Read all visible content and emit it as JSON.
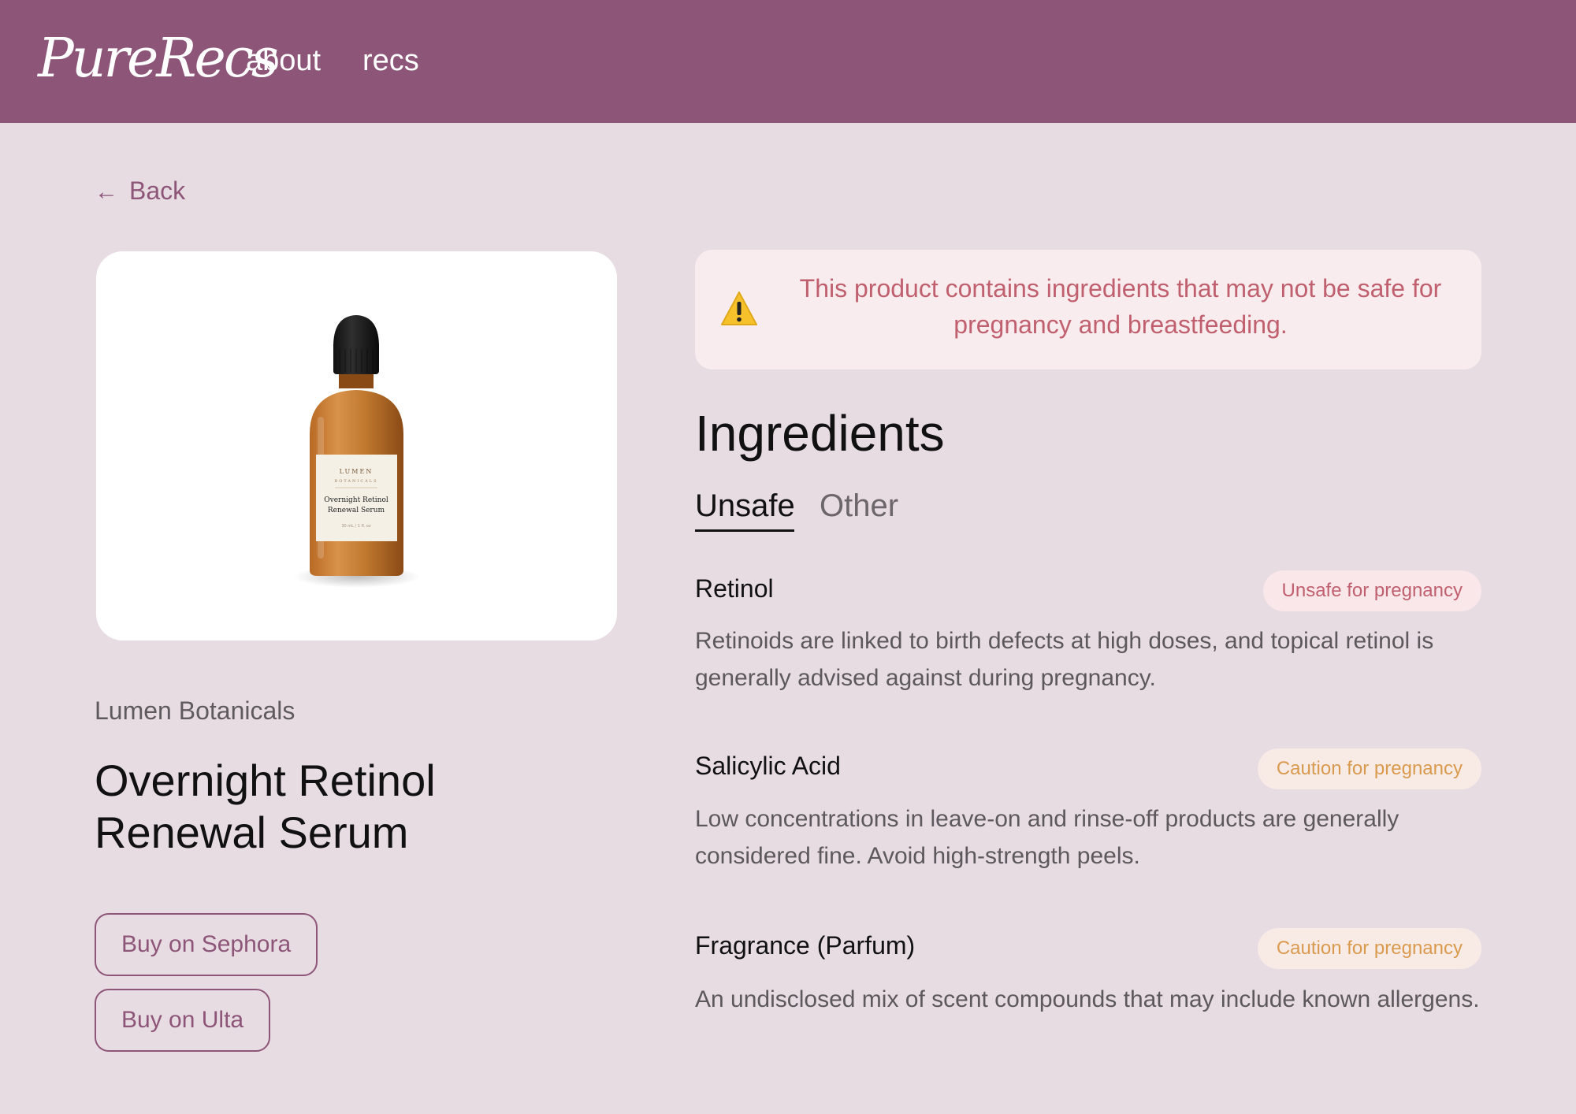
{
  "header": {
    "logo": "PureRecs",
    "nav": [
      {
        "label": "about"
      },
      {
        "label": "recs"
      }
    ]
  },
  "back": {
    "arrow": "←",
    "label": "Back"
  },
  "product": {
    "brand": "Lumen Botanicals",
    "title": "Overnight Retinol Renewal Serum",
    "image_label": {
      "brand_line1": "LUMEN",
      "brand_line2": "BOTANICALS",
      "name_line1": "Overnight Retinol",
      "name_line2": "Renewal Serum",
      "size": "30 mL / 1 fl. oz"
    },
    "buy_buttons": [
      {
        "label": "Buy on Sephora"
      },
      {
        "label": "Buy on Ulta"
      }
    ]
  },
  "warning": {
    "icon": "warning-icon",
    "text": "This product contains ingredients that may not be safe for pregnancy and breastfeeding."
  },
  "ingredients": {
    "title": "Ingredients",
    "tabs": [
      {
        "label": "Unsafe",
        "active": true
      },
      {
        "label": "Other",
        "active": false
      }
    ],
    "items": [
      {
        "name": "Retinol",
        "badge": "Unsafe for pregnancy",
        "badge_level": "unsafe",
        "description": "Retinoids are linked to birth defects at high doses, and topical retinol is generally advised against during pregnancy."
      },
      {
        "name": "Salicylic Acid",
        "badge": "Caution for pregnancy",
        "badge_level": "caution",
        "description": "Low concentrations in leave-on and rinse-off products are generally considered fine. Avoid high-strength peels."
      },
      {
        "name": "Fragrance (Parfum)",
        "badge": "Caution for pregnancy",
        "badge_level": "caution",
        "description": "An undisclosed mix of scent compounds that may include known allergens."
      }
    ]
  },
  "colors": {
    "header_bg": "#8d5578",
    "page_bg": "#e8dce3",
    "accent": "#8d5578",
    "unsafe_text": "#c0606f",
    "unsafe_bg": "#f9e7ea",
    "caution_text": "#d99a4e",
    "caution_bg": "#f8ebe6",
    "warning_bg": "#f9ecee"
  }
}
